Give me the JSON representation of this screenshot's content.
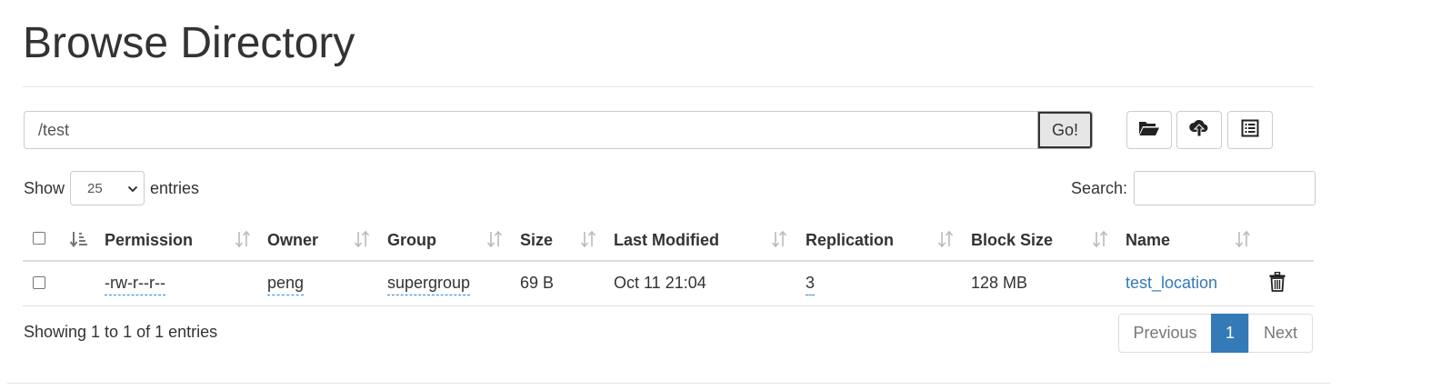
{
  "page": {
    "title": "Browse Directory"
  },
  "path_bar": {
    "value": "/test",
    "go_label": "Go!"
  },
  "toolbar": {
    "buttons": [
      {
        "icon": "folder-open-icon"
      },
      {
        "icon": "cloud-upload-icon"
      },
      {
        "icon": "list-alt-icon"
      }
    ]
  },
  "table_controls": {
    "show_label": "Show",
    "entries_value": "25",
    "entries_label": "entries",
    "search_label": "Search:",
    "search_value": ""
  },
  "table": {
    "columns": [
      "Permission",
      "Owner",
      "Group",
      "Size",
      "Last Modified",
      "Replication",
      "Block Size",
      "Name"
    ],
    "rows": [
      {
        "permission": "-rw-r--r--",
        "owner": "peng",
        "group": "supergroup",
        "size": "69 B",
        "last_modified": "Oct 11 21:04",
        "replication": "3",
        "block_size": "128 MB",
        "name": "test_location"
      }
    ]
  },
  "footer": {
    "info": "Showing 1 to 1 of 1 entries",
    "pagination": {
      "previous": "Previous",
      "current": "1",
      "next": "Next"
    }
  }
}
